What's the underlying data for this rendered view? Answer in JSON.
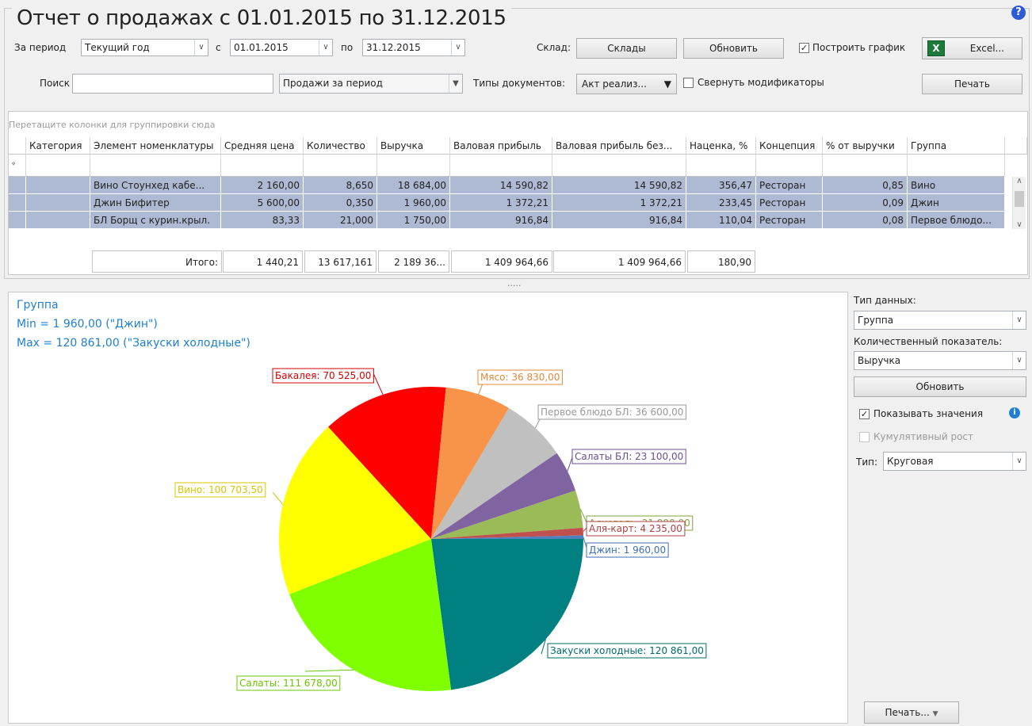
{
  "report": {
    "title": "Отчет о продажах с 01.01.2015 по 31.12.2015",
    "help": "?"
  },
  "filters": {
    "period_label": "За период",
    "period_value": "Текущий год",
    "from_label": "с",
    "from_value": "01.01.2015",
    "to_label": "по",
    "to_value": "31.12.2015",
    "warehouse_label": "Склад:",
    "warehouses_button": "Склады",
    "refresh_button": "Обновить",
    "build_chart_label": "Построить график",
    "build_chart_checked": "✓",
    "excel_button": "Excel...",
    "excel_icon": "X",
    "search_label": "Поиск",
    "search_value": "",
    "report_type_value": "Продажи за период",
    "doc_types_label": "Типы документов:",
    "doc_types_value": "Акт реализ...",
    "collapse_mods_label": "Свернуть модификаторы",
    "print_button": "Печать"
  },
  "grid": {
    "group_hint": "Перетащите колонки для группировки сюда",
    "filter_icon": "ᵠ",
    "columns": [
      "Категория",
      "Элемент номенклатуры",
      "Средняя цена",
      "Количество",
      "Выручка",
      "Валовая прибыль",
      "Валовая прибыль без...",
      "Наценка, %",
      "Концепция",
      "% от выручки",
      "Группа"
    ],
    "rows": [
      [
        "",
        "Вино Стоунхед кабе...",
        "2 160,00",
        "8,650",
        "18 684,00",
        "14 590,82",
        "14 590,82",
        "356,47",
        "Ресторан",
        "0,85",
        "Вино"
      ],
      [
        "",
        "Джин Бифитер",
        "5 600,00",
        "0,350",
        "1 960,00",
        "1 372,21",
        "1 372,21",
        "233,45",
        "Ресторан",
        "0,09",
        "Джин"
      ],
      [
        "",
        "БЛ Борщ с курин.крыл.",
        "83,33",
        "21,000",
        "1 750,00",
        "916,84",
        "916,84",
        "110,04",
        "Ресторан",
        "0,08",
        "Первое блюдо..."
      ]
    ],
    "totals_label": "Итого:",
    "totals": [
      "1 440,21",
      "13 617,161",
      "2 189 36...",
      "1 409 964,66",
      "1 409 964,66",
      "180,90"
    ],
    "splitter": "....."
  },
  "chart_info": {
    "title": "Группа",
    "min_text": "Min = 1 960,00 (\"Джин\")",
    "max_text": "Max = 120 861,00 (\"Закуски холодные\")"
  },
  "chart_data": {
    "type": "pie",
    "title": "Группа",
    "categories": [
      "Закуски холодные",
      "Салаты",
      "Вино",
      "Бакалея",
      "Мясо",
      "Первое блюдо БЛ",
      "Салаты БЛ",
      "Алкоголь",
      "Аля-карт",
      "Джин"
    ],
    "values": [
      120861,
      111678,
      100703.5,
      70525,
      36830,
      36600,
      23100,
      21000,
      4235,
      1960
    ],
    "labels": [
      "Закуски холодные: 120 861,00",
      "Салаты: 111 678,00",
      "Вино: 100 703,50",
      "Бакалея: 70 525,00",
      "Мясо: 36 830,00",
      "Первое блюдо БЛ: 36 600,00",
      "Салаты БЛ: 23 100,00",
      "Алкоголь: 21 000,00",
      "Аля-карт: 4 235,00",
      "Джин: 1 960,00"
    ],
    "colors": [
      "#008080",
      "#7fff00",
      "#ffff00",
      "#ff0000",
      "#f7944a",
      "#c0c0c0",
      "#8063a1",
      "#9bbb59",
      "#c0504d",
      "#4f81bd"
    ],
    "label_border_colors": [
      "#006b6b",
      "#6cc300",
      "#d6c700",
      "#d40000",
      "#e08a3a",
      "#999999",
      "#6a4f92",
      "#7fa33d",
      "#b04040",
      "#3e6fb0"
    ],
    "start_angle_deg": 0,
    "direction": "clockwise"
  },
  "side_panel": {
    "data_type_label": "Тип данных:",
    "data_type_value": "Группа",
    "measure_label": "Количественный показатель:",
    "measure_value": "Выручка",
    "refresh_button": "Обновить",
    "show_values_label": "Показывать значения",
    "show_values_checked": "✓",
    "info_icon": "i",
    "cumulative_label": "Кумулятивный рост",
    "type_label": "Тип:",
    "type_value": "Круговая",
    "print_button": "Печать..."
  }
}
